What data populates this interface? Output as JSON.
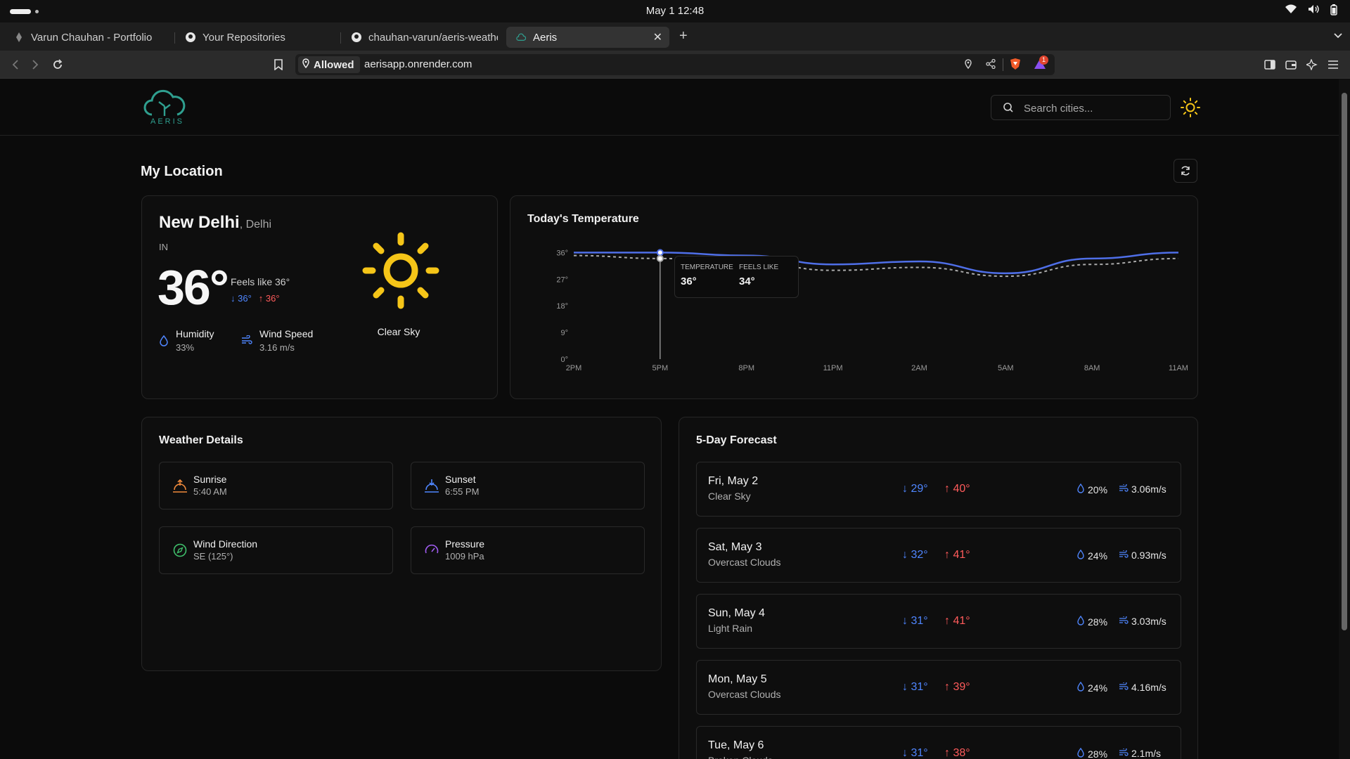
{
  "os": {
    "datetime": "May 1  12:48"
  },
  "browser": {
    "tabs": [
      {
        "title": "Varun Chauhan - Portfolio"
      },
      {
        "title": "Your Repositories"
      },
      {
        "title": "chauhan-varun/aeris-weathe"
      },
      {
        "title": "Aeris",
        "active": true
      }
    ],
    "permission": "Allowed",
    "url": "aerisapp.onrender.com",
    "notification_count": "1"
  },
  "app": {
    "logo_text": "AERIS",
    "search_placeholder": "Search cities...",
    "page_title": "My Location"
  },
  "current": {
    "city": "New Delhi",
    "region": ", Delhi",
    "country": "IN",
    "temp": "36°",
    "feels_like": "Feels like 36°",
    "min": "36°",
    "max": "36°",
    "humidity_label": "Humidity",
    "humidity": "33%",
    "wind_label": "Wind Speed",
    "wind": "3.16 m/s",
    "condition": "Clear Sky"
  },
  "chart_data": {
    "type": "line",
    "title": "Today's Temperature",
    "categories": [
      "2PM",
      "5PM",
      "8PM",
      "11PM",
      "2AM",
      "5AM",
      "8AM",
      "11AM"
    ],
    "y_ticks": [
      "0°",
      "9°",
      "18°",
      "27°",
      "36°"
    ],
    "ylim": [
      0,
      38
    ],
    "series": [
      {
        "name": "Temperature",
        "color": "#4f6fe8",
        "dashed": false,
        "values": [
          36,
          36,
          35,
          32,
          33,
          29,
          34,
          36
        ]
      },
      {
        "name": "Feels Like",
        "color": "#aaaaaa",
        "dashed": true,
        "values": [
          35,
          34,
          33,
          30,
          31,
          28,
          32,
          34
        ]
      }
    ],
    "tooltip": {
      "category": "5PM",
      "temp_label": "TEMPERATURE",
      "temp_value": "36°",
      "feels_label": "FEELS LIKE",
      "feels_value": "34°"
    }
  },
  "details": {
    "title": "Weather Details",
    "items": [
      {
        "label": "Sunrise",
        "value": "5:40 AM",
        "icon": "sunrise-icon",
        "color": "#f08a3c"
      },
      {
        "label": "Sunset",
        "value": "6:55 PM",
        "icon": "sunset-icon",
        "color": "#4f86ff"
      },
      {
        "label": "Wind Direction",
        "value": "SE (125°)",
        "icon": "compass-icon",
        "color": "#3fbf6b"
      },
      {
        "label": "Pressure",
        "value": "1009 hPa",
        "icon": "gauge-icon",
        "color": "#a05cf0"
      }
    ]
  },
  "forecast": {
    "title": "5-Day Forecast",
    "days": [
      {
        "day": "Fri, May 2",
        "desc": "Clear Sky",
        "min": "29°",
        "max": "40°",
        "humidity": "20%",
        "wind": "3.06m/s"
      },
      {
        "day": "Sat, May 3",
        "desc": "Overcast Clouds",
        "min": "32°",
        "max": "41°",
        "humidity": "24%",
        "wind": "0.93m/s"
      },
      {
        "day": "Sun, May 4",
        "desc": "Light Rain",
        "min": "31°",
        "max": "41°",
        "humidity": "28%",
        "wind": "3.03m/s"
      },
      {
        "day": "Mon, May 5",
        "desc": "Overcast Clouds",
        "min": "31°",
        "max": "39°",
        "humidity": "24%",
        "wind": "4.16m/s"
      },
      {
        "day": "Tue, May 6",
        "desc": "Broken Clouds",
        "min": "31°",
        "max": "38°",
        "humidity": "28%",
        "wind": "2.1m/s"
      }
    ]
  }
}
